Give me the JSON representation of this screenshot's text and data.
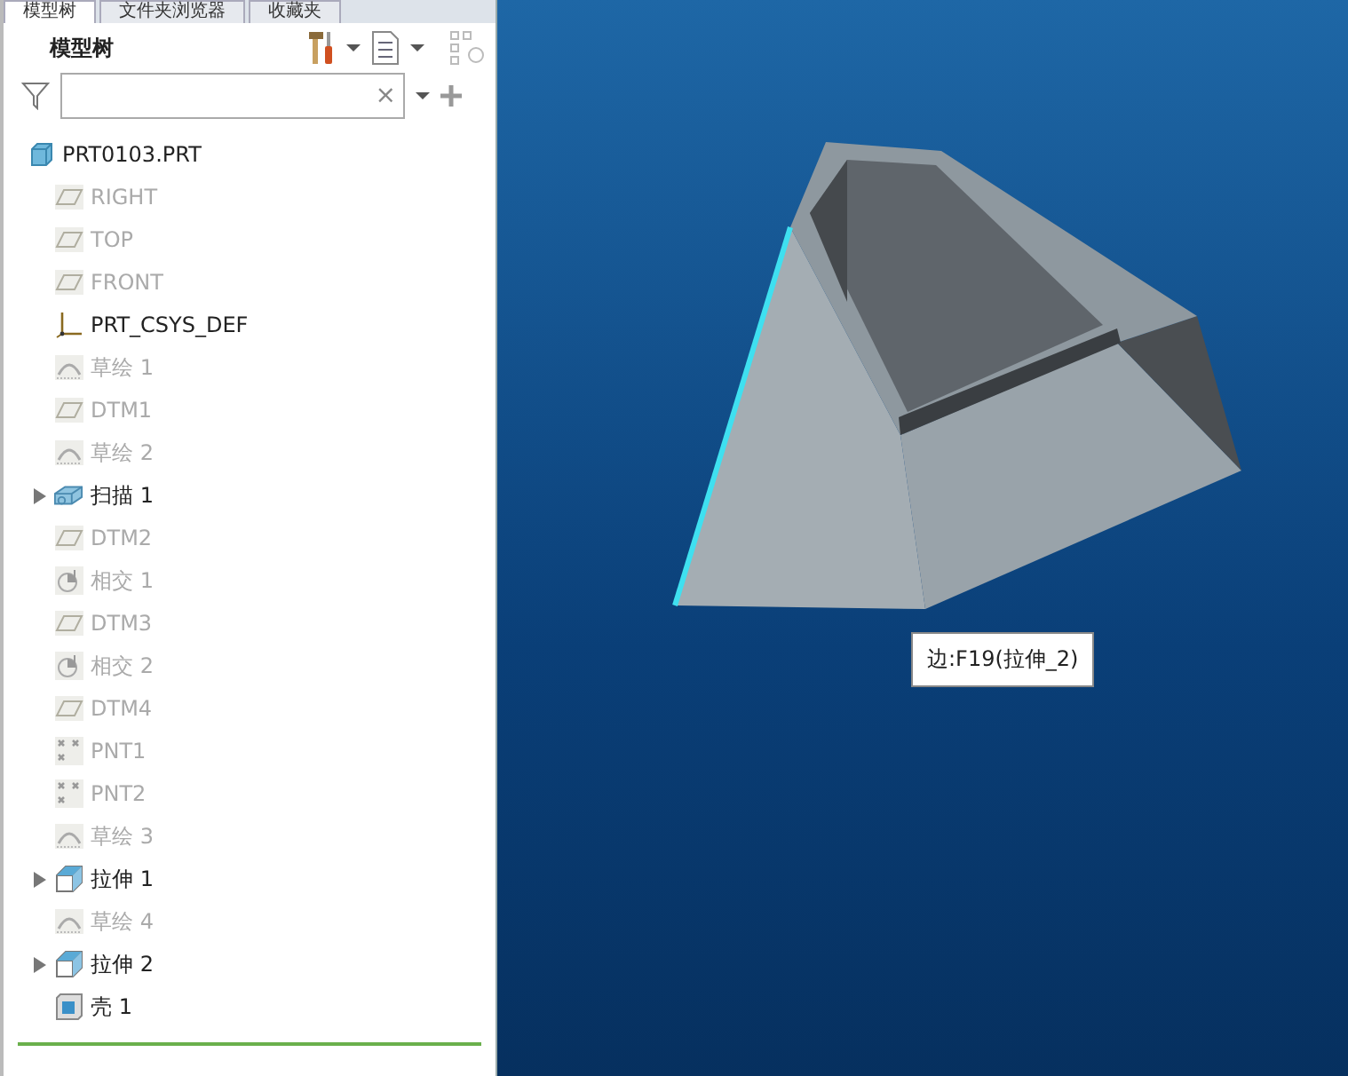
{
  "tabs": [
    {
      "label": "模型树",
      "selected": true
    },
    {
      "label": "文件夹浏览器",
      "selected": false
    },
    {
      "label": "收藏夹",
      "selected": false
    }
  ],
  "panel": {
    "title": "模型树",
    "search": {
      "clear": "×"
    }
  },
  "tree": {
    "label": "PRT0103.PRT",
    "kind": "part",
    "children": [
      {
        "label": "RIGHT",
        "kind": "plane",
        "disabled": true,
        "expander": false
      },
      {
        "label": "TOP",
        "kind": "plane",
        "disabled": true,
        "expander": false
      },
      {
        "label": "FRONT",
        "kind": "plane",
        "disabled": true,
        "expander": false
      },
      {
        "label": "PRT_CSYS_DEF",
        "kind": "csys",
        "disabled": false,
        "expander": false
      },
      {
        "label": "草绘 1",
        "kind": "sketch",
        "disabled": true,
        "expander": false
      },
      {
        "label": "DTM1",
        "kind": "plane",
        "disabled": true,
        "expander": false
      },
      {
        "label": "草绘 2",
        "kind": "sketch",
        "disabled": true,
        "expander": false
      },
      {
        "label": "扫描 1",
        "kind": "sweep",
        "disabled": false,
        "expander": true
      },
      {
        "label": "DTM2",
        "kind": "plane",
        "disabled": true,
        "expander": false
      },
      {
        "label": "相交 1",
        "kind": "intersect",
        "disabled": true,
        "expander": false
      },
      {
        "label": "DTM3",
        "kind": "plane",
        "disabled": true,
        "expander": false
      },
      {
        "label": "相交 2",
        "kind": "intersect",
        "disabled": true,
        "expander": false
      },
      {
        "label": "DTM4",
        "kind": "plane",
        "disabled": true,
        "expander": false
      },
      {
        "label": "PNT1",
        "kind": "point",
        "disabled": true,
        "expander": false
      },
      {
        "label": "PNT2",
        "kind": "point",
        "disabled": true,
        "expander": false
      },
      {
        "label": "草绘 3",
        "kind": "sketch",
        "disabled": true,
        "expander": false
      },
      {
        "label": "拉伸 1",
        "kind": "extrude",
        "disabled": false,
        "expander": true
      },
      {
        "label": "草绘 4",
        "kind": "sketch",
        "disabled": true,
        "expander": false
      },
      {
        "label": "拉伸 2",
        "kind": "extrude",
        "disabled": false,
        "expander": true
      },
      {
        "label": "壳 1",
        "kind": "shell",
        "disabled": false,
        "expander": false
      }
    ]
  },
  "viewport": {
    "tooltip": "边:F19(拉伸_2)"
  }
}
